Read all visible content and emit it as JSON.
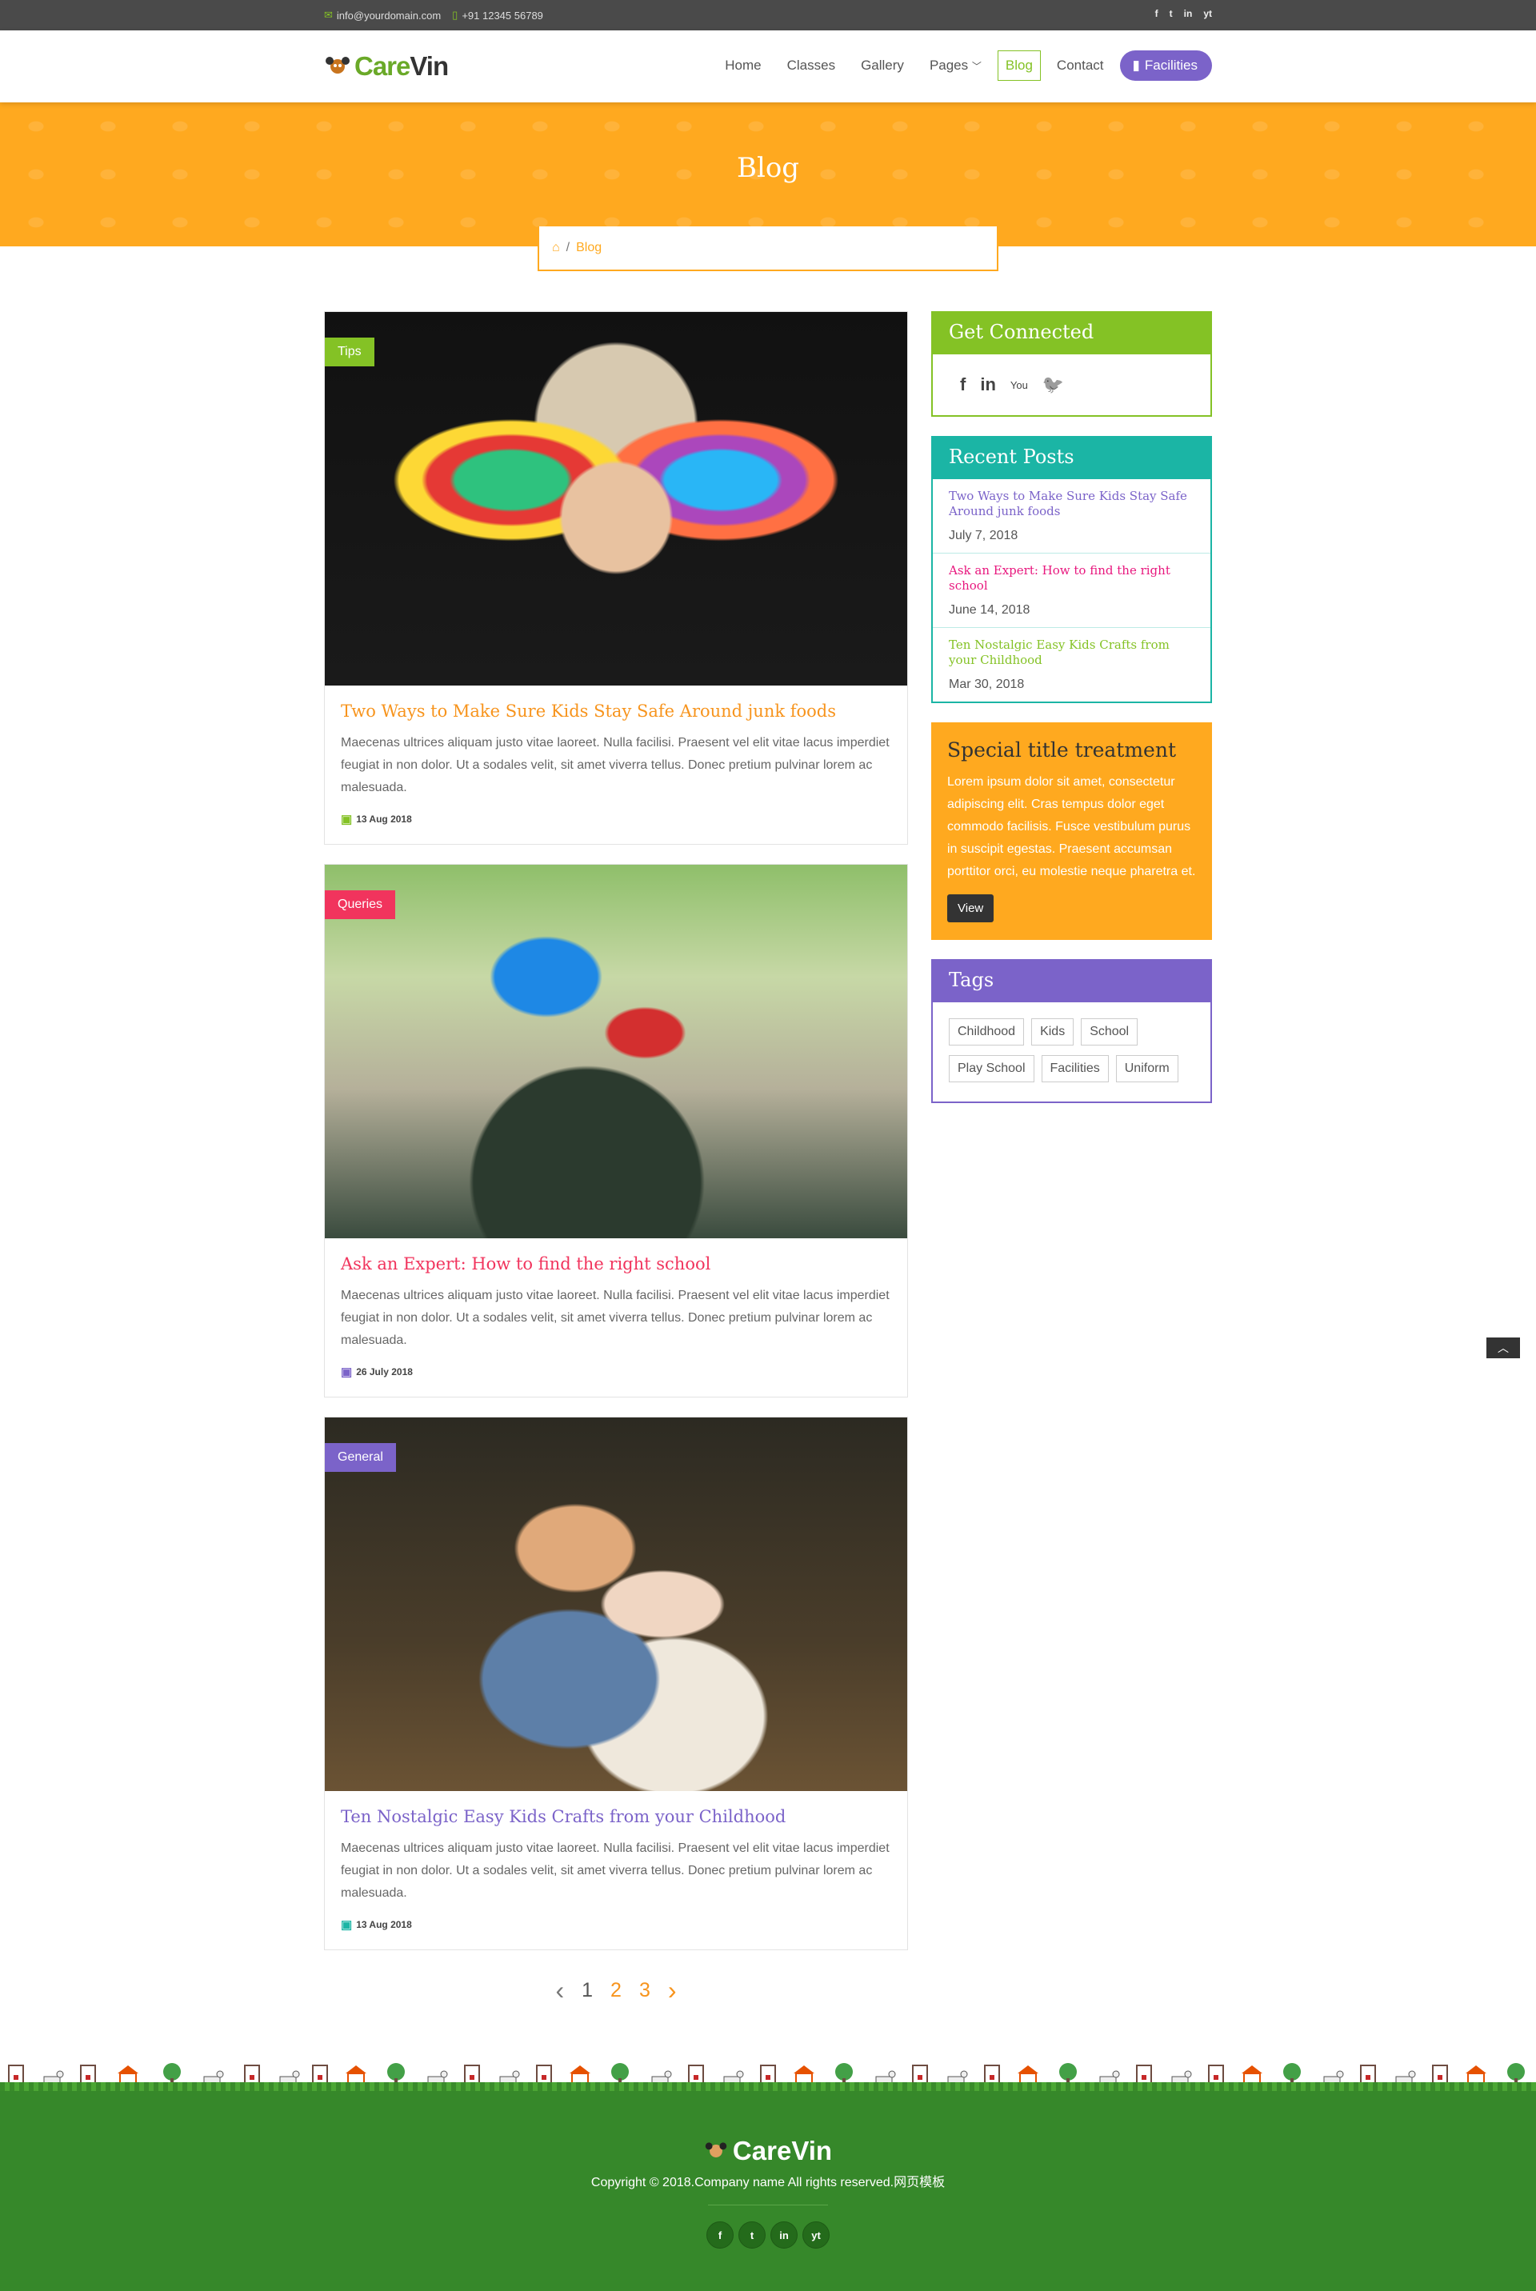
{
  "topbar": {
    "email": "info@yourdomain.com",
    "phone": "+91 12345 56789",
    "social": [
      "f",
      "t",
      "in",
      "yt"
    ]
  },
  "header": {
    "logo_care": "Care",
    "logo_vin": "Vin",
    "nav": [
      "Home",
      "Classes",
      "Gallery",
      "Pages",
      "Blog",
      "Contact"
    ],
    "nav_button": "Facilities"
  },
  "banner": {
    "title": "Blog",
    "breadcrumb_current": "Blog"
  },
  "posts": [
    {
      "tag": "Tips",
      "tag_color": "#84c225",
      "title": "Two Ways to Make Sure Kids Stay Safe Around junk foods",
      "title_color": "#f7941d",
      "excerpt": "Maecenas ultrices aliquam justo vitae laoreet. Nulla facilisi. Praesent vel elit vitae lacus imperdiet feugiat in non dolor. Ut a sodales velit, sit amet viverra tellus. Donec pretium pulvinar lorem ac malesuada.",
      "date": "13 Aug 2018",
      "date_icon_color": "#84c225"
    },
    {
      "tag": "Queries",
      "tag_color": "#f1345d",
      "title": "Ask an Expert: How to find the right school",
      "title_color": "#f1345d",
      "excerpt": "Maecenas ultrices aliquam justo vitae laoreet. Nulla facilisi. Praesent vel elit vitae lacus imperdiet feugiat in non dolor. Ut a sodales velit, sit amet viverra tellus. Donec pretium pulvinar lorem ac malesuada.",
      "date": "26 July 2018",
      "date_icon_color": "#7b63c9"
    },
    {
      "tag": "General",
      "tag_color": "#7b63c9",
      "title": "Ten Nostalgic Easy Kids Crafts from your Childhood",
      "title_color": "#7b63c9",
      "excerpt": "Maecenas ultrices aliquam justo vitae laoreet. Nulla facilisi. Praesent vel elit vitae lacus imperdiet feugiat in non dolor. Ut a sodales velit, sit amet viverra tellus. Donec pretium pulvinar lorem ac malesuada.",
      "date": "13 Aug 2018",
      "date_icon_color": "#1bb5a5"
    }
  ],
  "pagination": {
    "prev": "‹",
    "pages": [
      "1",
      "2",
      "3"
    ],
    "next": "›"
  },
  "sidebar": {
    "connected_title": "Get Connected",
    "connected_icons": [
      "f",
      "in",
      "You",
      "🐦"
    ],
    "recent_title": "Recent Posts",
    "recent": [
      {
        "title": "Two Ways to Make Sure Kids Stay Safe Around junk foods",
        "date": "July 7, 2018",
        "color": "#7b63c9"
      },
      {
        "title": "Ask an Expert: How to find the right school",
        "date": "June 14, 2018",
        "color": "#e8177e"
      },
      {
        "title": "Ten Nostalgic Easy Kids Crafts from your Childhood",
        "date": "Mar 30, 2018",
        "color": "#84c225"
      }
    ],
    "special_title": "Special title treatment",
    "special_text": "Lorem ipsum dolor sit amet, consectetur adipiscing elit. Cras tempus dolor eget commodo facilisis. Fusce vestibulum purus in suscipit egestas. Praesent accumsan porttitor orci, eu molestie neque pharetra et.",
    "special_button": "View",
    "tags_title": "Tags",
    "tags": [
      "Childhood",
      "Kids",
      "School",
      "Play School",
      "Facilities",
      "Uniform"
    ]
  },
  "footer": {
    "logo_care": "Care",
    "logo_vin": "Vin",
    "copyright": "Copyright © 2018.Company name All rights reserved.网页模板",
    "social": [
      "f",
      "t",
      "in",
      "yt"
    ]
  },
  "colors": {
    "orange": "#ffa91f",
    "green": "#84c225",
    "teal": "#1bb5a5",
    "purple": "#7b63c9",
    "footer": "#36882a"
  }
}
